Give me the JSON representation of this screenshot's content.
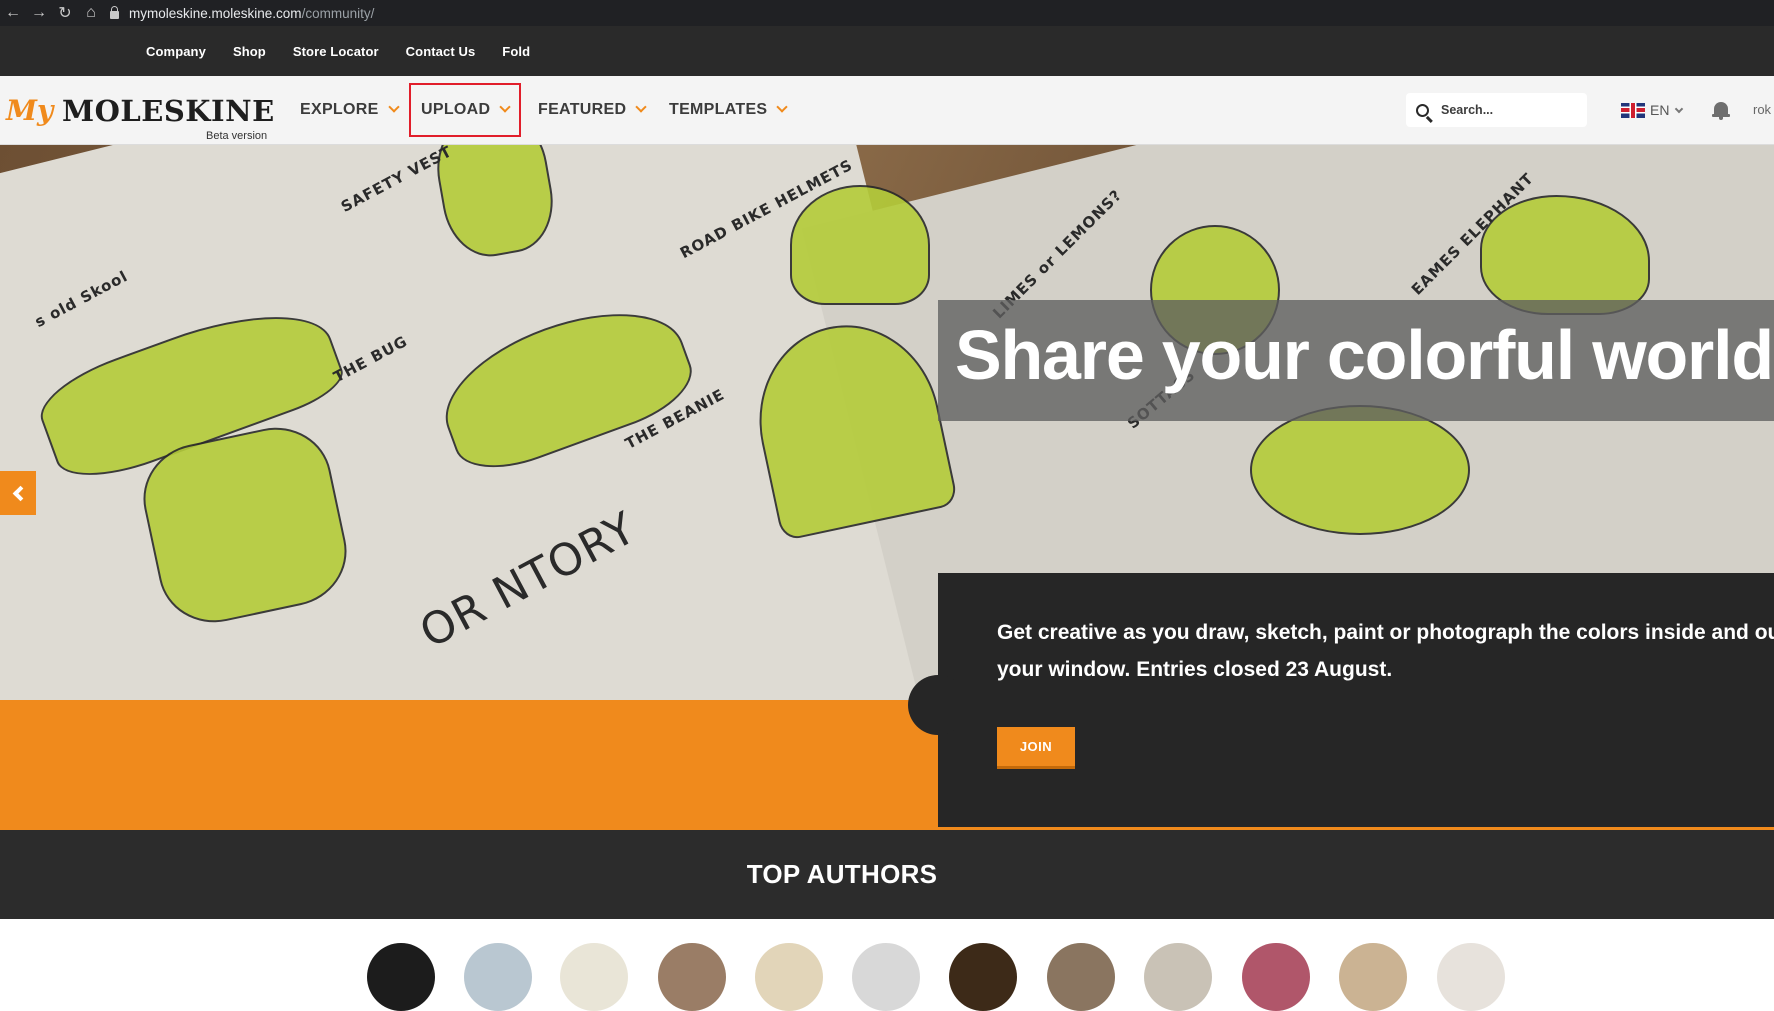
{
  "browser": {
    "url_host": "mymoleskine.moleskine.com",
    "url_path": "/community/"
  },
  "utility_nav": [
    "Company",
    "Shop",
    "Store Locator",
    "Contact Us",
    "Fold"
  ],
  "logo": {
    "my": "My",
    "brand": "MOLESKINE",
    "beta": "Beta version"
  },
  "main_nav": {
    "explore": "EXPLORE",
    "upload": "UPLOAD",
    "featured": "FEATURED",
    "templates": "TEMPLATES"
  },
  "search": {
    "placeholder": "Search..."
  },
  "language": {
    "code": "EN"
  },
  "user": {
    "name": "rok"
  },
  "hero": {
    "headline": "Share your colorful world",
    "description_line1": "Get creative as you draw, sketch, paint or photograph the colors inside and outsi",
    "description_line2": "your window. Entries closed 23 August.",
    "join_label": "JOIN"
  },
  "sketch_labels": [
    "SAFETY VEST",
    "ROAD BIKE HELMETS",
    "LIMES or LEMONS?",
    "EAMES ELEPHANT",
    "THE BUG",
    "THE BEANIE",
    "OR NTORY",
    "SOTTASS",
    "s old Skool"
  ],
  "top_authors": {
    "title": "TOP AUTHORS",
    "avatars": [
      {
        "name": "author-1",
        "color": "#1c1c1c"
      },
      {
        "name": "author-2",
        "color": "#b9c7d1"
      },
      {
        "name": "author-3",
        "color": "#e9e5d7"
      },
      {
        "name": "author-4",
        "color": "#9a7d66"
      },
      {
        "name": "author-5",
        "color": "#e2d5b9"
      },
      {
        "name": "author-6",
        "color": "#d8d8d8"
      },
      {
        "name": "author-7",
        "color": "#3d2a18"
      },
      {
        "name": "author-8",
        "color": "#8a7560"
      },
      {
        "name": "author-9",
        "color": "#c9c2b6"
      },
      {
        "name": "author-10",
        "color": "#b0566a"
      },
      {
        "name": "author-11",
        "color": "#cbb393"
      },
      {
        "name": "author-12",
        "color": "#e7e2dc"
      }
    ]
  },
  "colors": {
    "accent": "#f08a1c",
    "dark": "#262626",
    "highlight_box": "#e11d2a"
  }
}
